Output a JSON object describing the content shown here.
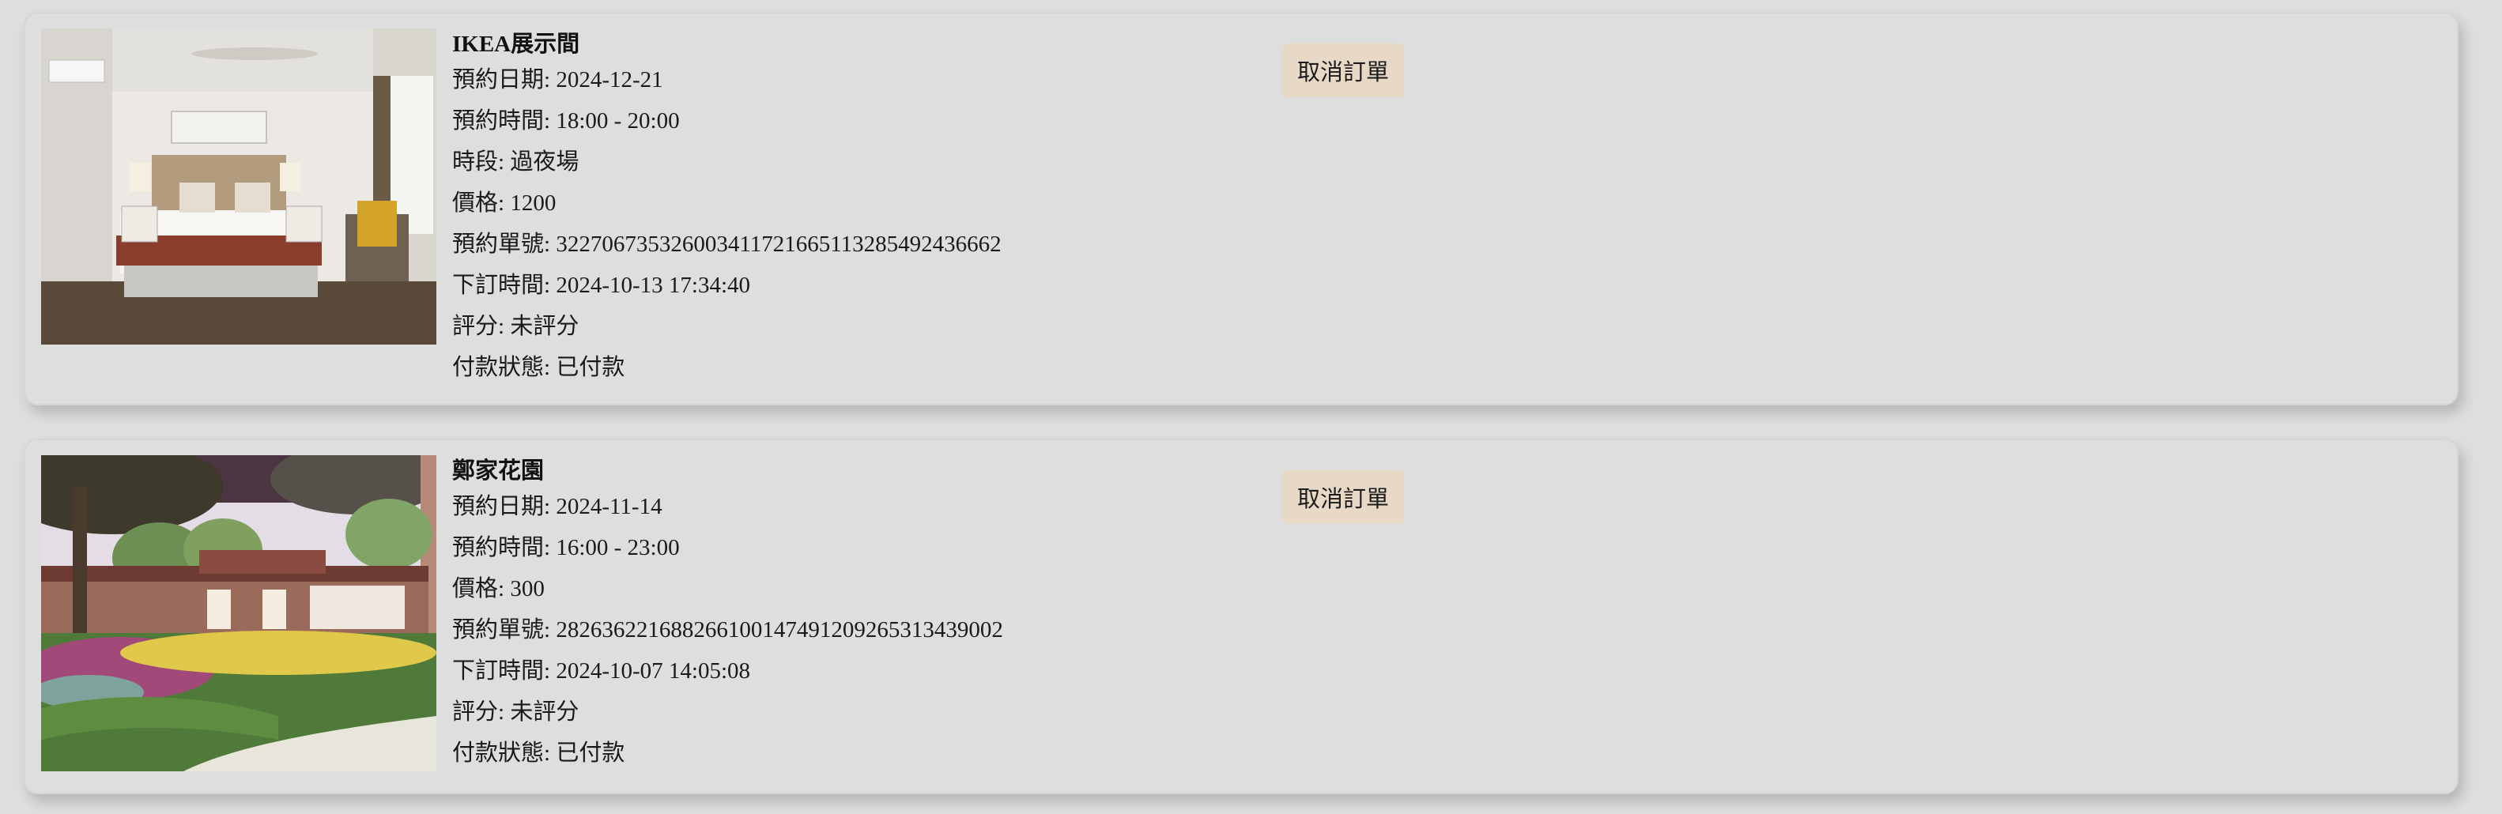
{
  "orders": [
    {
      "name": "IKEA展示間",
      "image": "bedroom-photo",
      "cancel_label": "取消訂單",
      "fields": [
        {
          "label": "預約日期",
          "value": "2024-12-21"
        },
        {
          "label": "預約時間",
          "value": "18:00 - 20:00"
        },
        {
          "label": "時段",
          "value": "過夜場"
        },
        {
          "label": "價格",
          "value": "1200"
        },
        {
          "label": "預約單號",
          "value": "3227067353260034117216651132854924366​62"
        },
        {
          "label": "下訂時間",
          "value": "2024-10-13 17:34:40"
        },
        {
          "label": "評分",
          "value": "未評分"
        },
        {
          "label": "付款狀態",
          "value": "已付款"
        }
      ]
    },
    {
      "name": "鄭家花園",
      "image": "garden-photo",
      "cancel_label": "取消訂單",
      "fields": [
        {
          "label": "預約日期",
          "value": "2024-11-14"
        },
        {
          "label": "預約時間",
          "value": "16:00 - 23:00"
        },
        {
          "label": "價格",
          "value": "300"
        },
        {
          "label": "預約單號",
          "value": "282636221688266100147491209265313439002"
        },
        {
          "label": "下訂時間",
          "value": "2024-10-07 14:05:08"
        },
        {
          "label": "評分",
          "value": "未評分"
        },
        {
          "label": "付款狀態",
          "value": "已付款"
        }
      ]
    }
  ],
  "separator": ": ",
  "colors": {
    "page_bg": "#dedede",
    "card_border": "#d6d6d6",
    "button_bg": "#e8d9c6"
  }
}
